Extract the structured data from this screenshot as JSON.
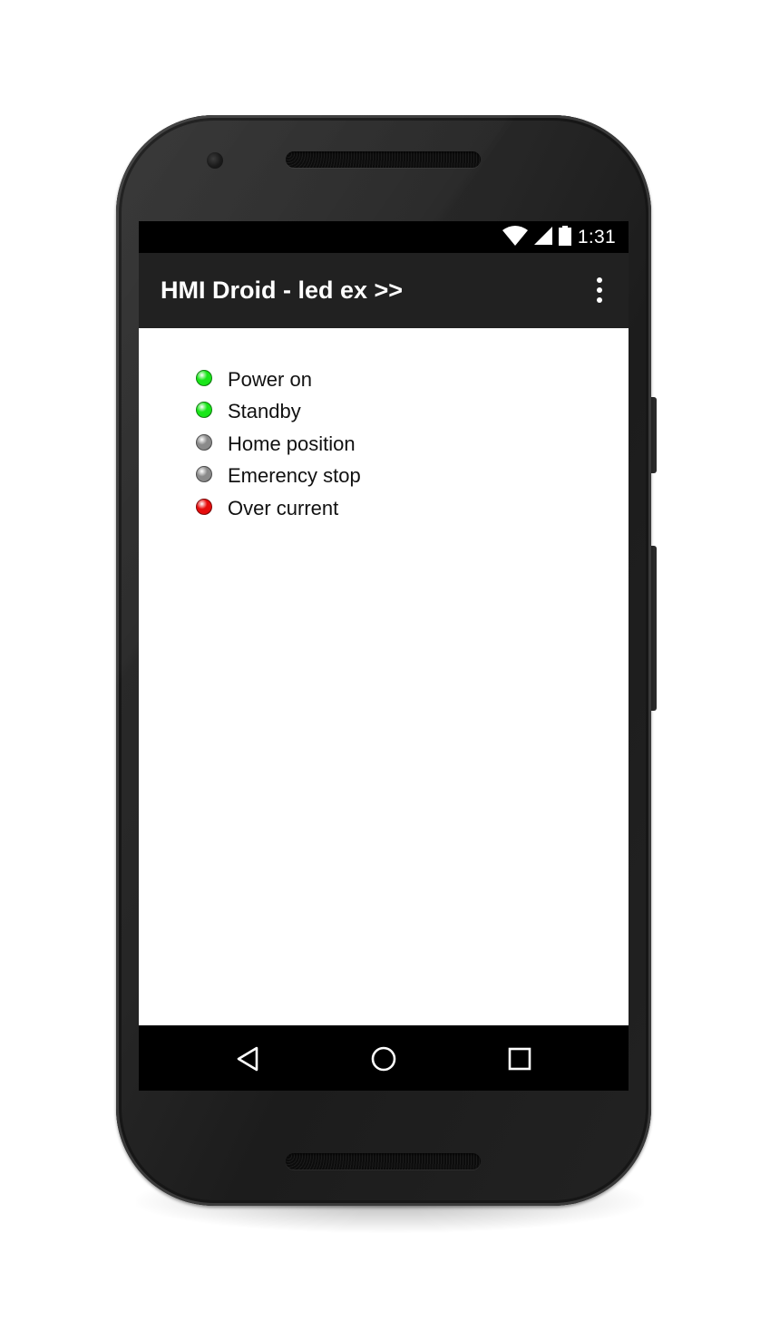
{
  "status_bar": {
    "time": "1:31",
    "icons": [
      "wifi-icon",
      "cell-signal-icon",
      "battery-icon"
    ]
  },
  "app_bar": {
    "title": "HMI Droid - led ex >>",
    "overflow_icon": "more-vert-icon"
  },
  "leds": [
    {
      "label": "Power on",
      "state": "on",
      "color": "#19e619"
    },
    {
      "label": "Standby",
      "state": "on",
      "color": "#19e619"
    },
    {
      "label": "Home position",
      "state": "off",
      "color": "#8a8a8a"
    },
    {
      "label": "Emerency stop",
      "state": "off",
      "color": "#8a8a8a"
    },
    {
      "label": "Over current",
      "state": "on",
      "color": "#e60c0c"
    }
  ],
  "nav_bar": {
    "buttons": [
      "back-icon",
      "home-icon",
      "recents-icon"
    ]
  },
  "colors": {
    "status_bar_bg": "#000000",
    "app_bar_bg": "#212121",
    "nav_bar_bg": "#000000",
    "content_bg": "#ffffff"
  }
}
